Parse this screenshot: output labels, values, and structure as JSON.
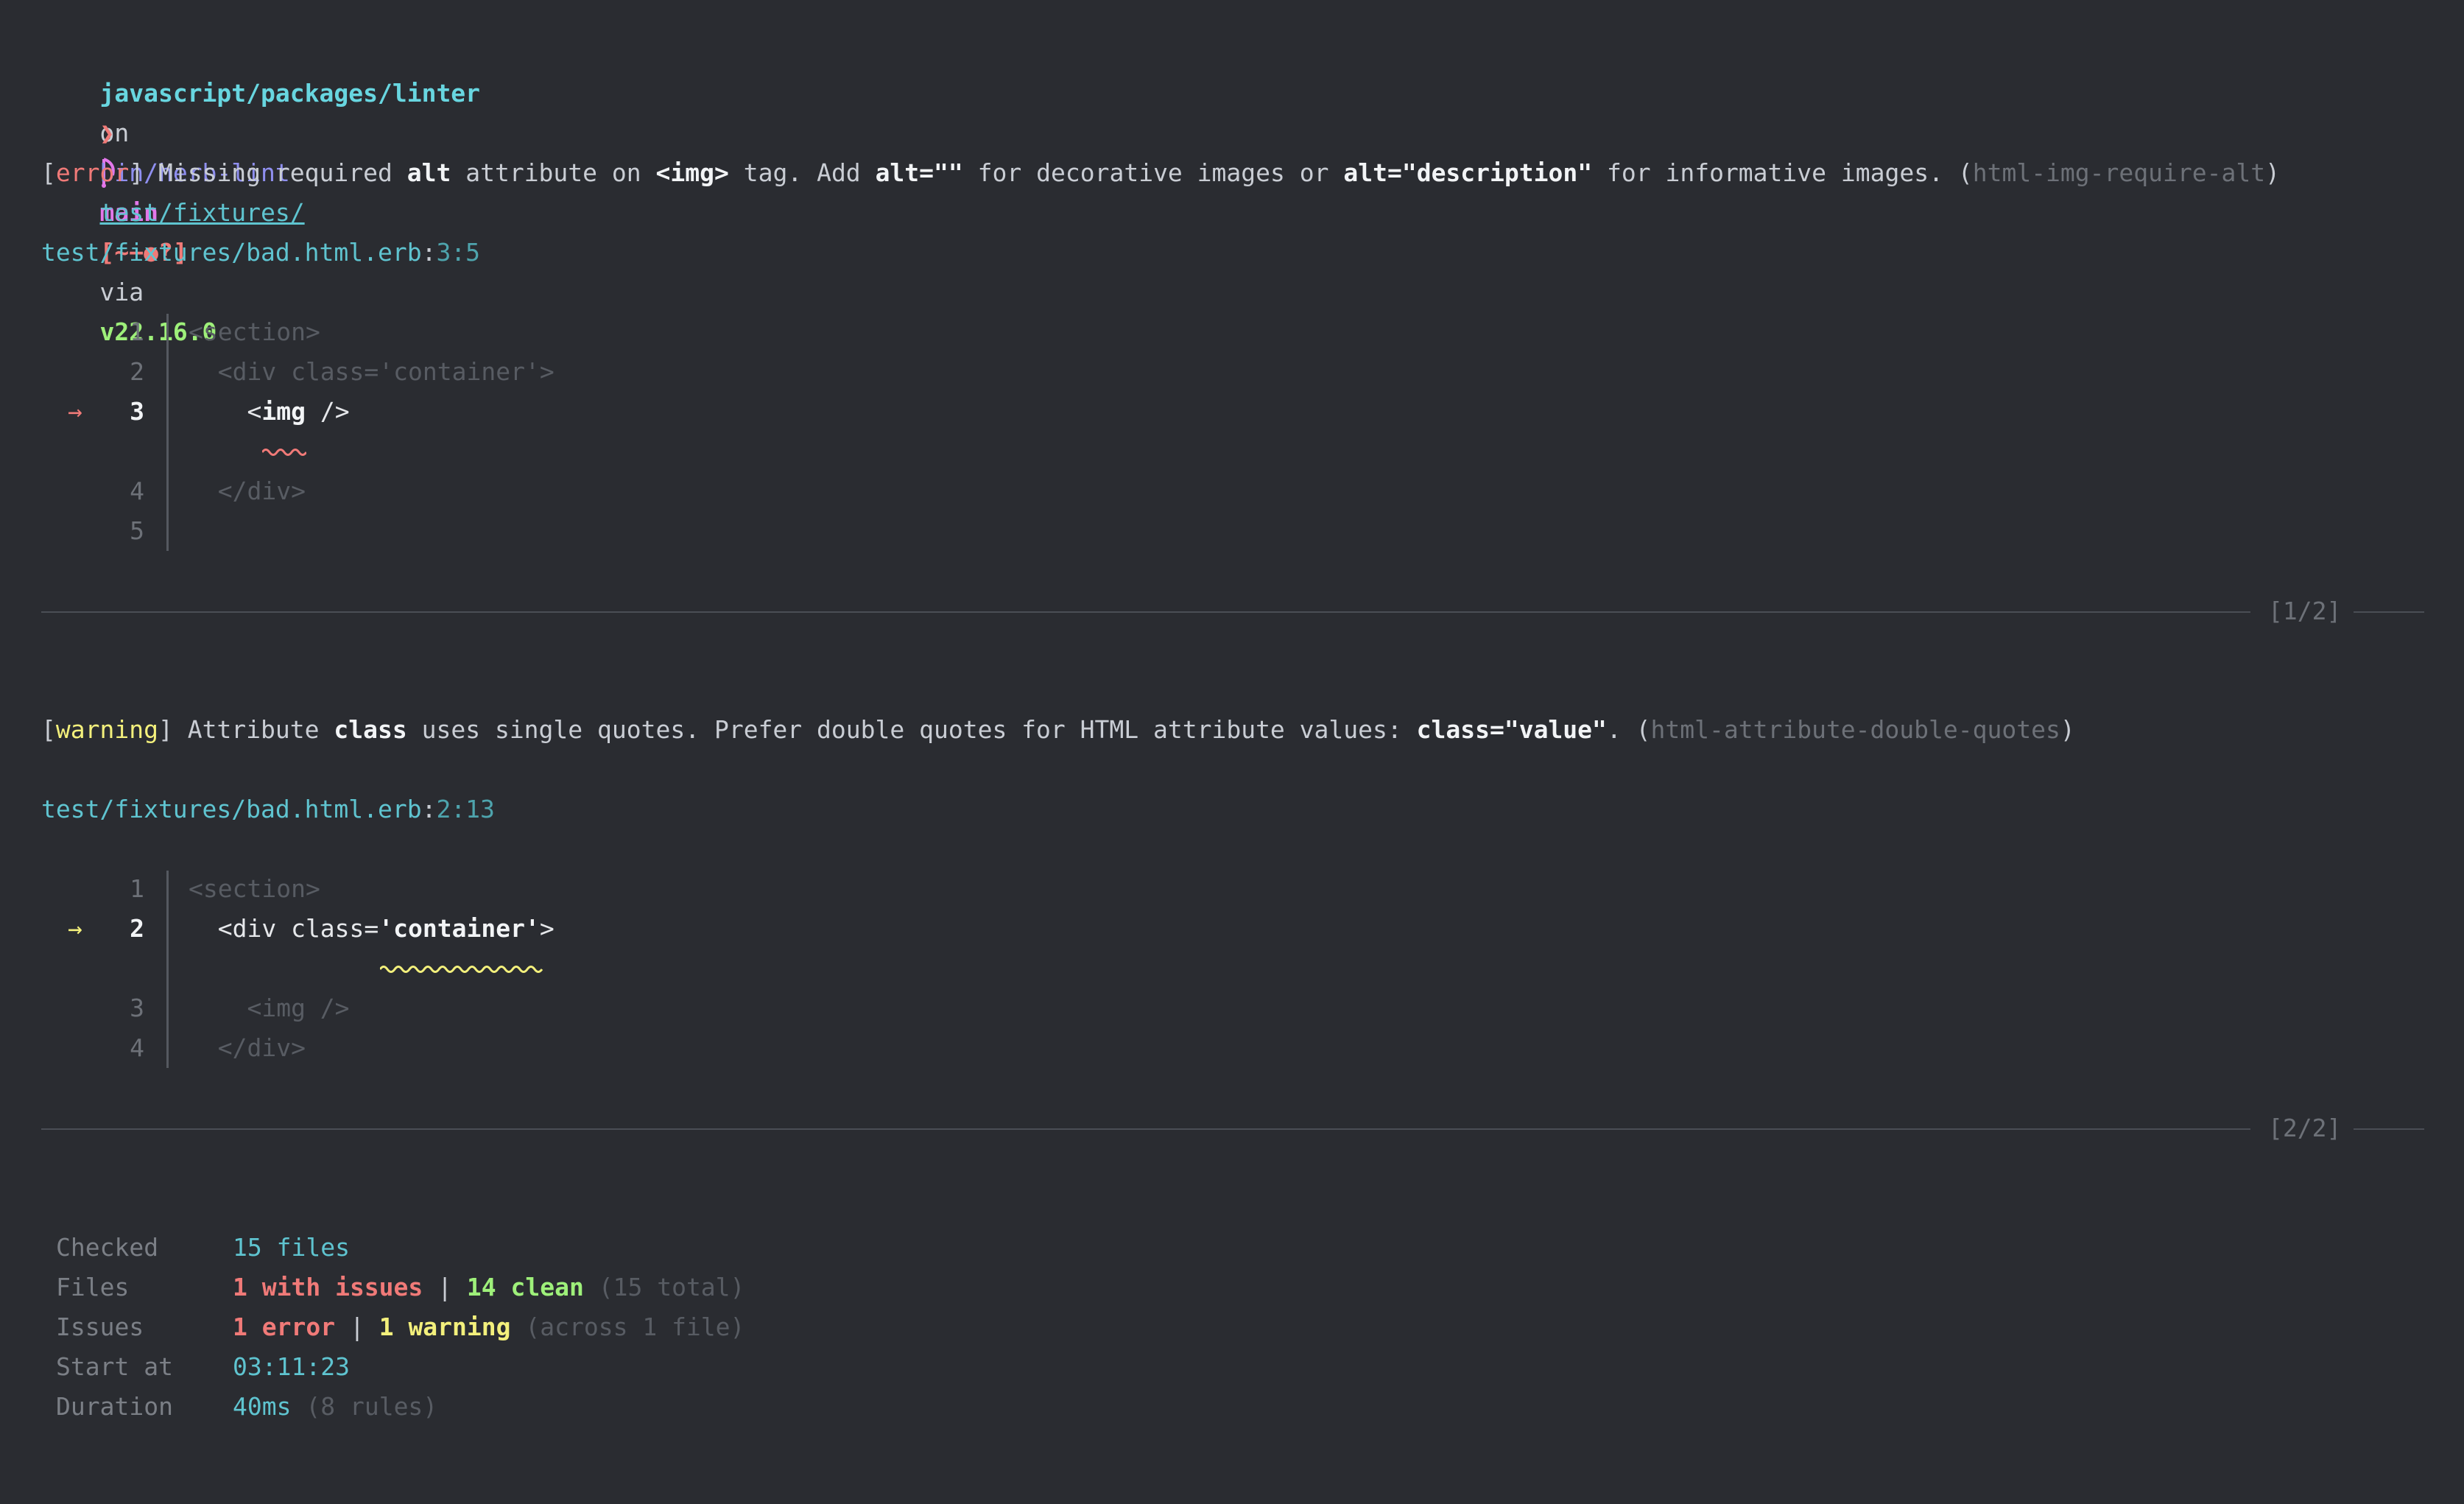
{
  "prompt": {
    "path": "javascript/packages/linter",
    "on": "on",
    "branch_icon": "git-branch-icon",
    "branch": "main",
    "status": "[~−●?]",
    "via": "via",
    "node_version": "v22.16.0",
    "prompt_char": "❯",
    "command": "bin/herb-lint",
    "arg": "test/fixtures/"
  },
  "diagnostics": [
    {
      "level": "error",
      "msg_1": "Missing required",
      "kw_1": "alt",
      "msg_2": "attribute on",
      "kw_2": "<img>",
      "msg_3": "tag. Add",
      "kw_3": "alt=\"\"",
      "msg_4": "for decorative images or",
      "kw_4": "alt=\"description\"",
      "msg_5": "for informative images.",
      "rule": "html-img-require-alt",
      "file": "test/fixtures/bad.html.erb",
      "location": "3:5",
      "lines": [
        {
          "num": "1",
          "text": "<section>"
        },
        {
          "num": "2",
          "text": "  <div class='container'>"
        },
        {
          "num": "3",
          "pre": "    <",
          "hl": "img",
          "post": " />"
        },
        {
          "num": "4",
          "text": "  </div>"
        },
        {
          "num": "5",
          "text": ""
        }
      ],
      "counter": "[1/2]"
    },
    {
      "level": "warning",
      "msg_1": "Attribute",
      "kw_1": "class",
      "msg_2": "uses single quotes. Prefer double quotes for HTML attribute values:",
      "kw_2": "class=\"value\"",
      "msg_3": ".",
      "rule": "html-attribute-double-quotes",
      "file": "test/fixtures/bad.html.erb",
      "location": "2:13",
      "lines": [
        {
          "num": "1",
          "text": "<section>"
        },
        {
          "num": "2",
          "pre": "  <div class=",
          "hl": "'container'",
          "post": ">"
        },
        {
          "num": "3",
          "text": "    <img />"
        },
        {
          "num": "4",
          "text": "  </div>"
        }
      ],
      "counter": "[2/2]"
    }
  ],
  "summary": {
    "checked_label": "Checked",
    "checked_value": "15 files",
    "files_label": "Files",
    "files_issues": "1 with issues",
    "files_sep": "|",
    "files_clean": "14 clean",
    "files_total": "(15 total)",
    "issues_label": "Issues",
    "issues_error": "1 error",
    "issues_sep": "|",
    "issues_warning": "1 warning",
    "issues_scope": "(across 1 file)",
    "start_label": "Start at",
    "start_value": "03:11:23",
    "duration_label": "Duration",
    "duration_value": "40ms",
    "duration_rules": "(8 rules)"
  },
  "arrow_glyph": "→",
  "colors": {
    "background": "#2a2c31",
    "error": "#f07a78",
    "warning": "#f3f07c",
    "path": "#68d6e0",
    "branch": "#e377ea",
    "ok": "#9ef07a"
  }
}
